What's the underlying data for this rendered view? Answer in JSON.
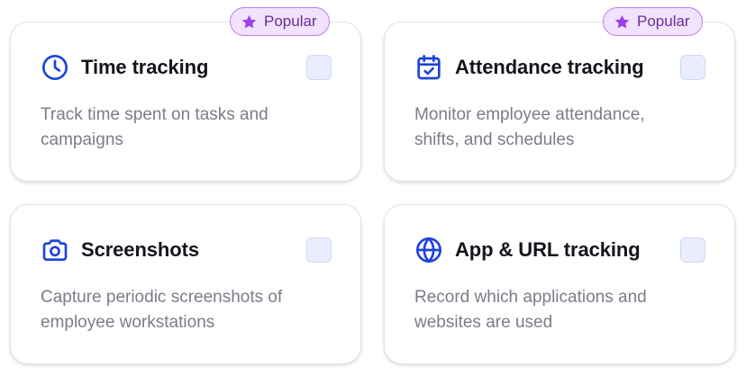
{
  "colors": {
    "icon_blue": "#1e43d8",
    "title": "#14151c",
    "description": "#7a7d88",
    "checkbox_fill": "#eaedfd",
    "badge_fill": "#f1e2fd",
    "badge_border": "#c17cf3",
    "badge_star": "#9b3fe6"
  },
  "badges": [
    {
      "label": "Popular",
      "icon": "star-icon"
    },
    {
      "label": "Popular",
      "icon": "star-icon"
    }
  ],
  "cards": [
    {
      "icon": "clock-icon",
      "title": "Time tracking",
      "description": "Track time spent on tasks and campaigns",
      "checked": false,
      "popular": true
    },
    {
      "icon": "calendar-check-icon",
      "title": "Attendance tracking",
      "description": "Monitor employee attendance, shifts, and schedules",
      "checked": false,
      "popular": true
    },
    {
      "icon": "camera-icon",
      "title": "Screenshots",
      "description": "Capture periodic screenshots of employee workstations",
      "checked": false,
      "popular": false
    },
    {
      "icon": "globe-icon",
      "title": "App & URL tracking",
      "description": "Record which applications and websites are used",
      "checked": false,
      "popular": false
    }
  ]
}
